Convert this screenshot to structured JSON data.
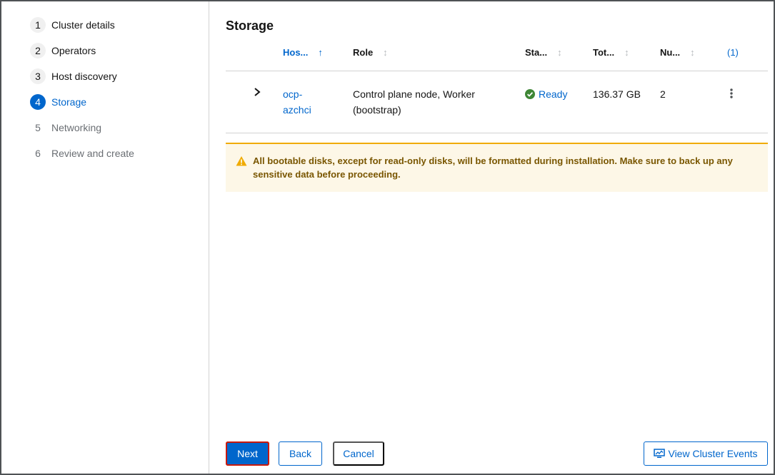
{
  "wizard": {
    "steps": [
      {
        "number": "1",
        "label": "Cluster details"
      },
      {
        "number": "2",
        "label": "Operators"
      },
      {
        "number": "3",
        "label": "Host discovery"
      },
      {
        "number": "4",
        "label": "Storage"
      },
      {
        "number": "5",
        "label": "Networking"
      },
      {
        "number": "6",
        "label": "Review and create"
      }
    ]
  },
  "page": {
    "title": "Storage"
  },
  "table": {
    "columns": {
      "hostname": "Hos...",
      "role": "Role",
      "status": "Sta...",
      "total": "Tot...",
      "number": "Nu...",
      "count": "(1)"
    },
    "rows": [
      {
        "hostname_line1": "ocp-",
        "hostname_line2": "azchci",
        "role_line1": "Control plane node, Worker",
        "role_line2": "(bootstrap)",
        "status": "Ready",
        "total": "136.37 GB",
        "number": "2"
      }
    ]
  },
  "alert": {
    "message": "All bootable disks, except for read-only disks, will be formatted during installation. Make sure to back up any sensitive data before proceeding."
  },
  "footer": {
    "next_label": "Next",
    "back_label": "Back",
    "cancel_label": "Cancel",
    "events_label": "View Cluster Events"
  },
  "colors": {
    "primary": "#0066cc",
    "success": "#3e8635",
    "warning": "#f0ab00",
    "highlight": "#c9190b"
  }
}
